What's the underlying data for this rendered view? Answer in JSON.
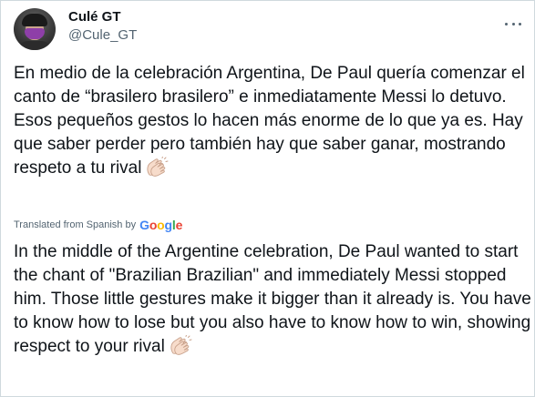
{
  "user": {
    "display_name": "Culé GT",
    "handle": "@Cule_GT"
  },
  "tweet": {
    "text": "En medio de la celebración Argentina, De Paul quería comenzar el canto de “brasilero brasilero” e inmediatamente Messi lo detuvo. Esos pequeños gestos lo hacen más enorme de lo que ya es. Hay que saber perder pero también hay que saber ganar, mostrando respeto a tu rival",
    "emoji": "clapping-hands",
    "translated_label": "Translated from Spanish by",
    "translation_provider": [
      "G",
      "o",
      "o",
      "g",
      "l",
      "e"
    ],
    "translation": "In the middle of the Argentine celebration, De Paul wanted to start the chant of \"Brazilian Brazilian\" and immediately Messi stopped him. Those little gestures make it bigger than it already is. You have to know how to lose but you also have to know how to win, showing respect to your rival"
  },
  "colors": {
    "text": "#0f1419",
    "secondary": "#536471",
    "border": "#cfd9de",
    "google": [
      "#4285f4",
      "#ea4335",
      "#fbbc05",
      "#4285f4",
      "#34a853",
      "#ea4335"
    ]
  },
  "icons": {
    "more": "more-horizontal-icon"
  }
}
